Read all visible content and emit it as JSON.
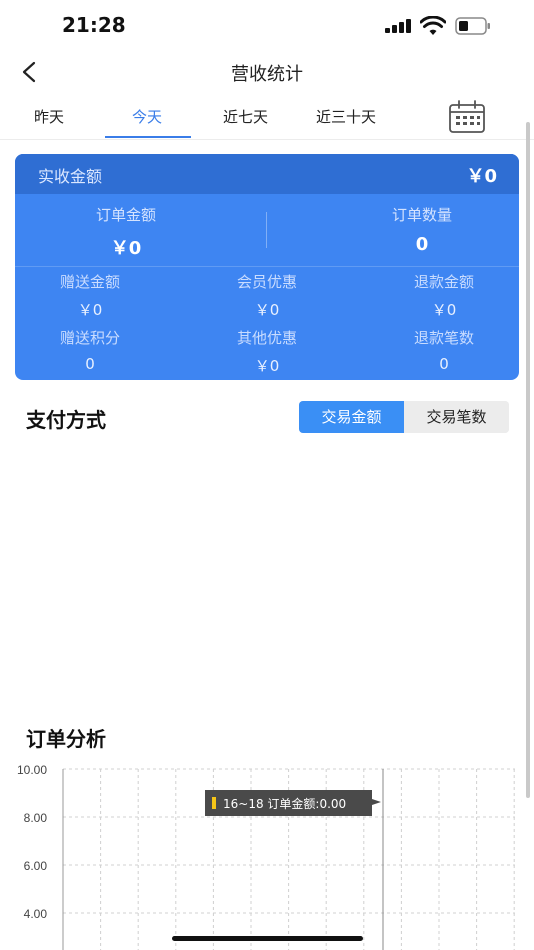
{
  "status_bar": {
    "time": "21:28"
  },
  "nav": {
    "title": "营收统计"
  },
  "tabs": [
    {
      "label": "昨天"
    },
    {
      "label": "今天",
      "active": true
    },
    {
      "label": "近七天"
    },
    {
      "label": "近三十天"
    }
  ],
  "summary": {
    "received_label": "实收金额",
    "received_value": "￥0",
    "order_amount_label": "订单金额",
    "order_amount_value": "￥0",
    "order_count_label": "订单数量",
    "order_count_value": "0",
    "stats": [
      {
        "label": "赠送金额",
        "value": "￥0"
      },
      {
        "label": "会员优惠",
        "value": "￥0"
      },
      {
        "label": "退款金额",
        "value": "￥0"
      },
      {
        "label": "赠送积分",
        "value": "0"
      },
      {
        "label": "其他优惠",
        "value": "￥0"
      },
      {
        "label": "退款笔数",
        "value": "0"
      }
    ]
  },
  "payment": {
    "title": "支付方式",
    "toggle_active": "交易金额",
    "toggle_inactive": "交易笔数"
  },
  "order_analysis": {
    "title": "订单分析",
    "tooltip": "16~18 订单金额:0.00"
  },
  "chart_data": {
    "type": "line",
    "y_ticks": [
      "10.00",
      "8.00",
      "6.00",
      "4.00"
    ],
    "ylim": [
      0,
      10
    ],
    "series": [
      {
        "values": []
      }
    ]
  },
  "colors": {
    "accent": "#3a7de8",
    "card": "#3e85f2",
    "card_header": "#2f6ed3",
    "tooltip_marker": "#f5c518"
  },
  "icons": {
    "back": "chevron-left-icon",
    "calendar": "calendar-icon"
  }
}
